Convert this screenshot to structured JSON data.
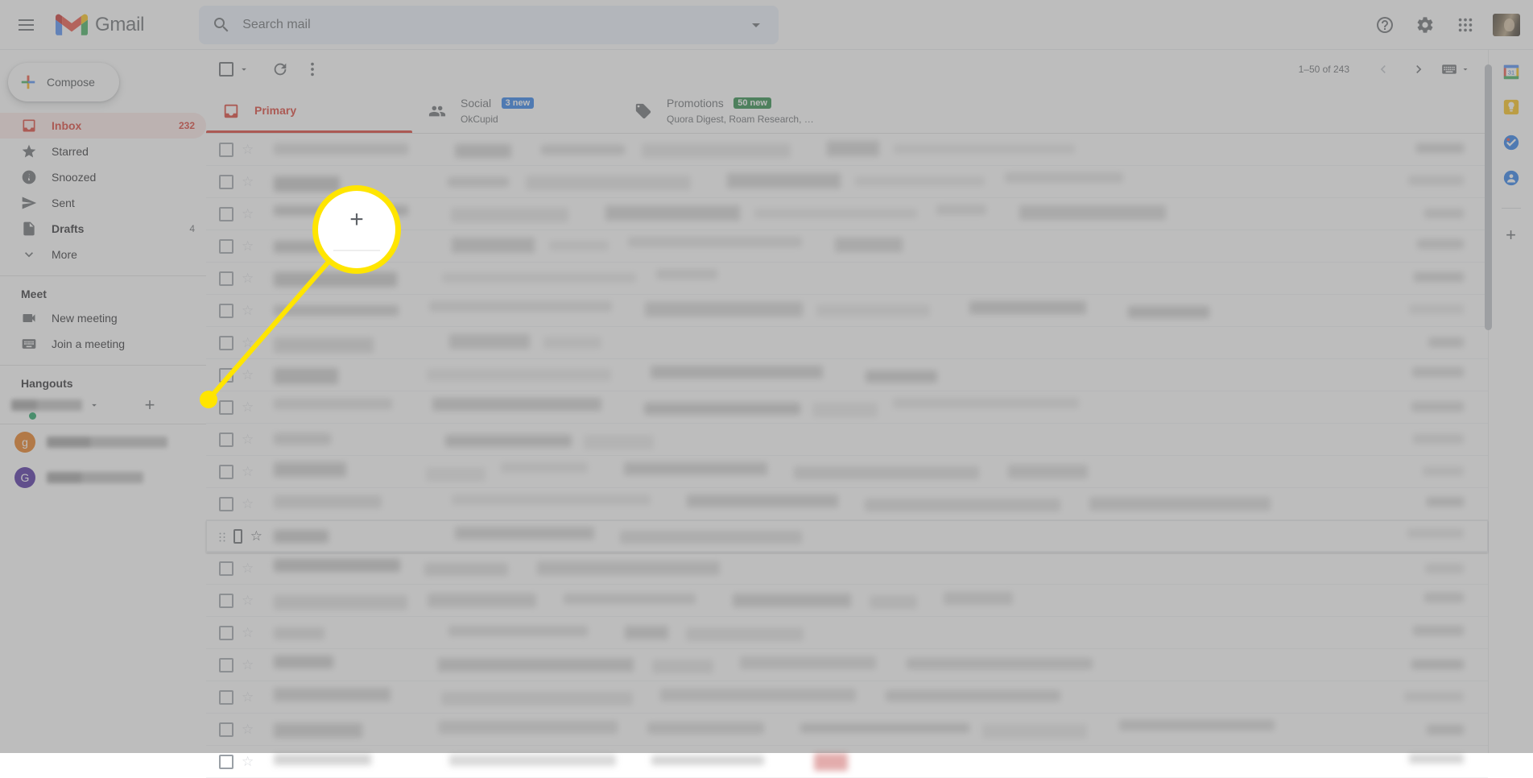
{
  "header": {
    "menu_icon": "hamburger-menu-icon",
    "logo_icon": "gmail-logo-icon",
    "brand": "Gmail",
    "search": {
      "icon": "search-icon",
      "placeholder": "Search mail",
      "value": "",
      "options_icon": "chevron-down-icon"
    },
    "actions": [
      {
        "name": "help-icon",
        "label": "Help"
      },
      {
        "name": "settings-gear-icon",
        "label": "Settings"
      },
      {
        "name": "google-apps-grid-icon",
        "label": "Google apps"
      },
      {
        "name": "avatar",
        "label": "Account"
      }
    ]
  },
  "sidebar": {
    "compose": {
      "label": "Compose",
      "icon": "plus-icon"
    },
    "items": [
      {
        "label": "Inbox",
        "count": "232",
        "icon": "inbox-icon",
        "active": true
      },
      {
        "label": "Starred",
        "count": "",
        "icon": "star-icon",
        "active": false
      },
      {
        "label": "Snoozed",
        "count": "",
        "icon": "clock-icon",
        "active": false
      },
      {
        "label": "Sent",
        "count": "",
        "icon": "send-icon",
        "active": false
      },
      {
        "label": "Drafts",
        "count": "4",
        "icon": "draft-icon",
        "active": false,
        "bold": true
      },
      {
        "label": "More",
        "count": "",
        "icon": "chevron-down-icon",
        "active": false
      }
    ],
    "meet": {
      "title": "Meet",
      "items": [
        {
          "label": "New meeting",
          "icon": "video-camera-icon"
        },
        {
          "label": "Join a meeting",
          "icon": "keyboard-icon"
        }
      ]
    },
    "hangouts": {
      "title": "Hangouts",
      "self_name_redacted": true,
      "status": "available",
      "caret_icon": "chevron-down-icon",
      "add_icon": "plus-icon",
      "contacts": [
        {
          "initial": "g",
          "color": "#e8710a",
          "name_redacted": true
        },
        {
          "initial": "G",
          "color": "#3f1b99",
          "name_redacted": true
        }
      ]
    }
  },
  "toolbar": {
    "select_all": {
      "icon": "checkbox-icon",
      "caret_icon": "chevron-down-icon"
    },
    "refresh": {
      "icon": "refresh-icon",
      "label": "Refresh"
    },
    "more": {
      "icon": "more-vertical-icon",
      "label": "More"
    },
    "pagination": {
      "range": "1–50 of 243",
      "prev_icon": "chevron-left-icon",
      "next_icon": "chevron-right-icon",
      "input_tools_icon": "keyboard-icon",
      "input_tools_caret": "chevron-down-icon"
    }
  },
  "tabs": [
    {
      "label": "Primary",
      "icon": "inbox-icon",
      "badge": "",
      "badge_color": "",
      "subtitle": "",
      "active": true
    },
    {
      "label": "Social",
      "icon": "people-icon",
      "badge": "3 new",
      "badge_color": "#1a73e8",
      "subtitle": "OkCupid",
      "active": false
    },
    {
      "label": "Promotions",
      "icon": "tag-icon",
      "badge": "50 new",
      "badge_color": "#188038",
      "subtitle": "Quora Digest, Roam Research, …",
      "active": false
    }
  ],
  "email_rows": [
    {
      "hover": false,
      "redacted": true
    },
    {
      "hover": false,
      "redacted": true
    },
    {
      "hover": false,
      "redacted": true
    },
    {
      "hover": false,
      "redacted": true
    },
    {
      "hover": false,
      "redacted": true
    },
    {
      "hover": false,
      "redacted": true
    },
    {
      "hover": false,
      "redacted": true
    },
    {
      "hover": false,
      "redacted": true
    },
    {
      "hover": false,
      "redacted": true
    },
    {
      "hover": false,
      "redacted": true
    },
    {
      "hover": false,
      "redacted": true
    },
    {
      "hover": false,
      "redacted": true
    },
    {
      "hover": true,
      "redacted": true
    },
    {
      "hover": false,
      "redacted": true
    },
    {
      "hover": false,
      "redacted": true
    },
    {
      "hover": false,
      "redacted": true
    },
    {
      "hover": false,
      "redacted": true
    },
    {
      "hover": false,
      "redacted": true
    },
    {
      "hover": false,
      "redacted": true
    },
    {
      "hover": false,
      "redacted": true
    }
  ],
  "right_rail": {
    "items": [
      {
        "name": "google-calendar-icon",
        "label": "Calendar",
        "day": "31"
      },
      {
        "name": "google-keep-icon",
        "label": "Keep"
      },
      {
        "name": "google-tasks-icon",
        "label": "Tasks"
      },
      {
        "name": "google-contacts-icon",
        "label": "Contacts"
      }
    ],
    "add": {
      "icon": "plus-icon",
      "label": "Get add-ons"
    }
  },
  "callout": {
    "highlight_color": "#ffe500",
    "magnifier_glyph": "+",
    "target": "hangouts-add-contact-button"
  }
}
